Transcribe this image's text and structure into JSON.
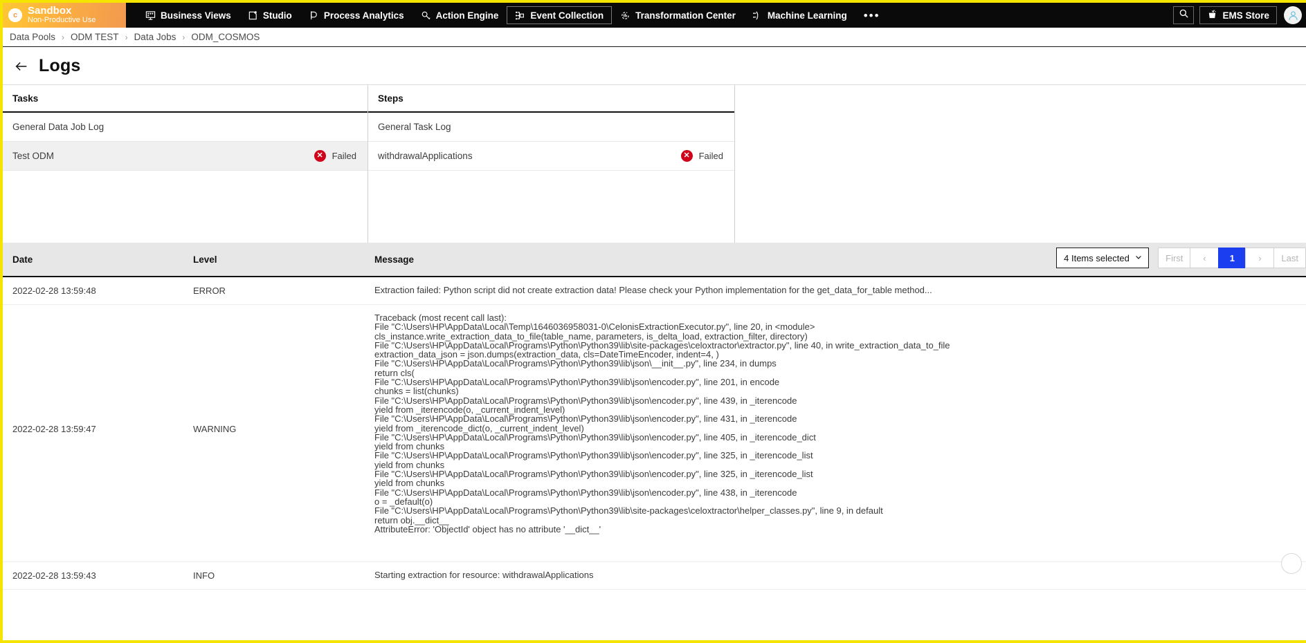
{
  "brand": {
    "title": "Sandbox",
    "subtitle": "Non-Productive Use",
    "logo_glyph": "c"
  },
  "topnav": {
    "items": [
      {
        "label": "Business Views",
        "icon": "business-views-icon",
        "active": false
      },
      {
        "label": "Studio",
        "icon": "studio-icon",
        "active": false
      },
      {
        "label": "Process Analytics",
        "icon": "process-analytics-icon",
        "active": false
      },
      {
        "label": "Action Engine",
        "icon": "action-engine-icon",
        "active": false
      },
      {
        "label": "Event Collection",
        "icon": "event-collection-icon",
        "active": true
      },
      {
        "label": "Transformation Center",
        "icon": "transformation-center-icon",
        "active": false
      },
      {
        "label": "Machine Learning",
        "icon": "machine-learning-icon",
        "active": false
      }
    ],
    "more_label": "•••",
    "search_icon": "search-icon",
    "store_label": "EMS Store",
    "avatar_glyph": "●"
  },
  "breadcrumb": {
    "items": [
      "Data Pools",
      "ODM TEST",
      "Data Jobs",
      "ODM_COSMOS"
    ],
    "separator": "›"
  },
  "header": {
    "title": "Logs",
    "back_icon": "arrow-left-icon"
  },
  "tasks_pane": {
    "header": "Tasks",
    "rows": [
      {
        "label": "General Data Job Log",
        "status": "",
        "selected": false
      },
      {
        "label": "Test ODM",
        "status": "Failed",
        "selected": true
      }
    ]
  },
  "steps_pane": {
    "header": "Steps",
    "rows": [
      {
        "label": "General Task Log",
        "status": "",
        "selected": false
      },
      {
        "label": "withdrawalApplications",
        "status": "Failed",
        "selected": false
      }
    ]
  },
  "log_table": {
    "columns": {
      "date": "Date",
      "level": "Level",
      "message": "Message"
    },
    "pagination": {
      "select_value": "4 Items selected",
      "first": "First",
      "prev": "‹",
      "page": "1",
      "next": "›",
      "last": "Last"
    },
    "rows": [
      {
        "date": "2022-02-28 13:59:48",
        "level": "ERROR",
        "message": "Extraction failed: Python script did not create extraction data! Please check your Python implementation for the get_data_for_table method..."
      },
      {
        "date": "2022-02-28 13:59:47",
        "level": "WARNING",
        "message": "Traceback (most recent call last):\nFile \"C:\\Users\\HP\\AppData\\Local\\Temp\\1646036958031-0\\CelonisExtractionExecutor.py\", line 20, in <module>\ncls_instance.write_extraction_data_to_file(table_name, parameters, is_delta_load, extraction_filter, directory)\nFile \"C:\\Users\\HP\\AppData\\Local\\Programs\\Python\\Python39\\lib\\site-packages\\celoxtractor\\extractor.py\", line 40, in write_extraction_data_to_file\nextraction_data_json = json.dumps(extraction_data, cls=DateTimeEncoder, indent=4, )\nFile \"C:\\Users\\HP\\AppData\\Local\\Programs\\Python\\Python39\\lib\\json\\__init__.py\", line 234, in dumps\nreturn cls(\nFile \"C:\\Users\\HP\\AppData\\Local\\Programs\\Python\\Python39\\lib\\json\\encoder.py\", line 201, in encode\nchunks = list(chunks)\nFile \"C:\\Users\\HP\\AppData\\Local\\Programs\\Python\\Python39\\lib\\json\\encoder.py\", line 439, in _iterencode\nyield from _iterencode(o, _current_indent_level)\nFile \"C:\\Users\\HP\\AppData\\Local\\Programs\\Python\\Python39\\lib\\json\\encoder.py\", line 431, in _iterencode\nyield from _iterencode_dict(o, _current_indent_level)\nFile \"C:\\Users\\HP\\AppData\\Local\\Programs\\Python\\Python39\\lib\\json\\encoder.py\", line 405, in _iterencode_dict\nyield from chunks\nFile \"C:\\Users\\HP\\AppData\\Local\\Programs\\Python\\Python39\\lib\\json\\encoder.py\", line 325, in _iterencode_list\nyield from chunks\nFile \"C:\\Users\\HP\\AppData\\Local\\Programs\\Python\\Python39\\lib\\json\\encoder.py\", line 325, in _iterencode_list\nyield from chunks\nFile \"C:\\Users\\HP\\AppData\\Local\\Programs\\Python\\Python39\\lib\\json\\encoder.py\", line 438, in _iterencode\no = _default(o)\nFile \"C:\\Users\\HP\\AppData\\Local\\Programs\\Python\\Python39\\lib\\site-packages\\celoxtractor\\helper_classes.py\", line 9, in default\nreturn obj.__dict__\nAttributeError: 'ObjectId' object has no attribute '__dict__'"
      },
      {
        "date": "2022-02-28 13:59:43",
        "level": "INFO",
        "message": "Starting extraction for resource: withdrawalApplications"
      }
    ]
  },
  "colors": {
    "brand_yellow": "#f5e400",
    "nav_black": "#0a0a0a",
    "status_failed": "#d0021b",
    "page_active": "#1a3ef0"
  }
}
